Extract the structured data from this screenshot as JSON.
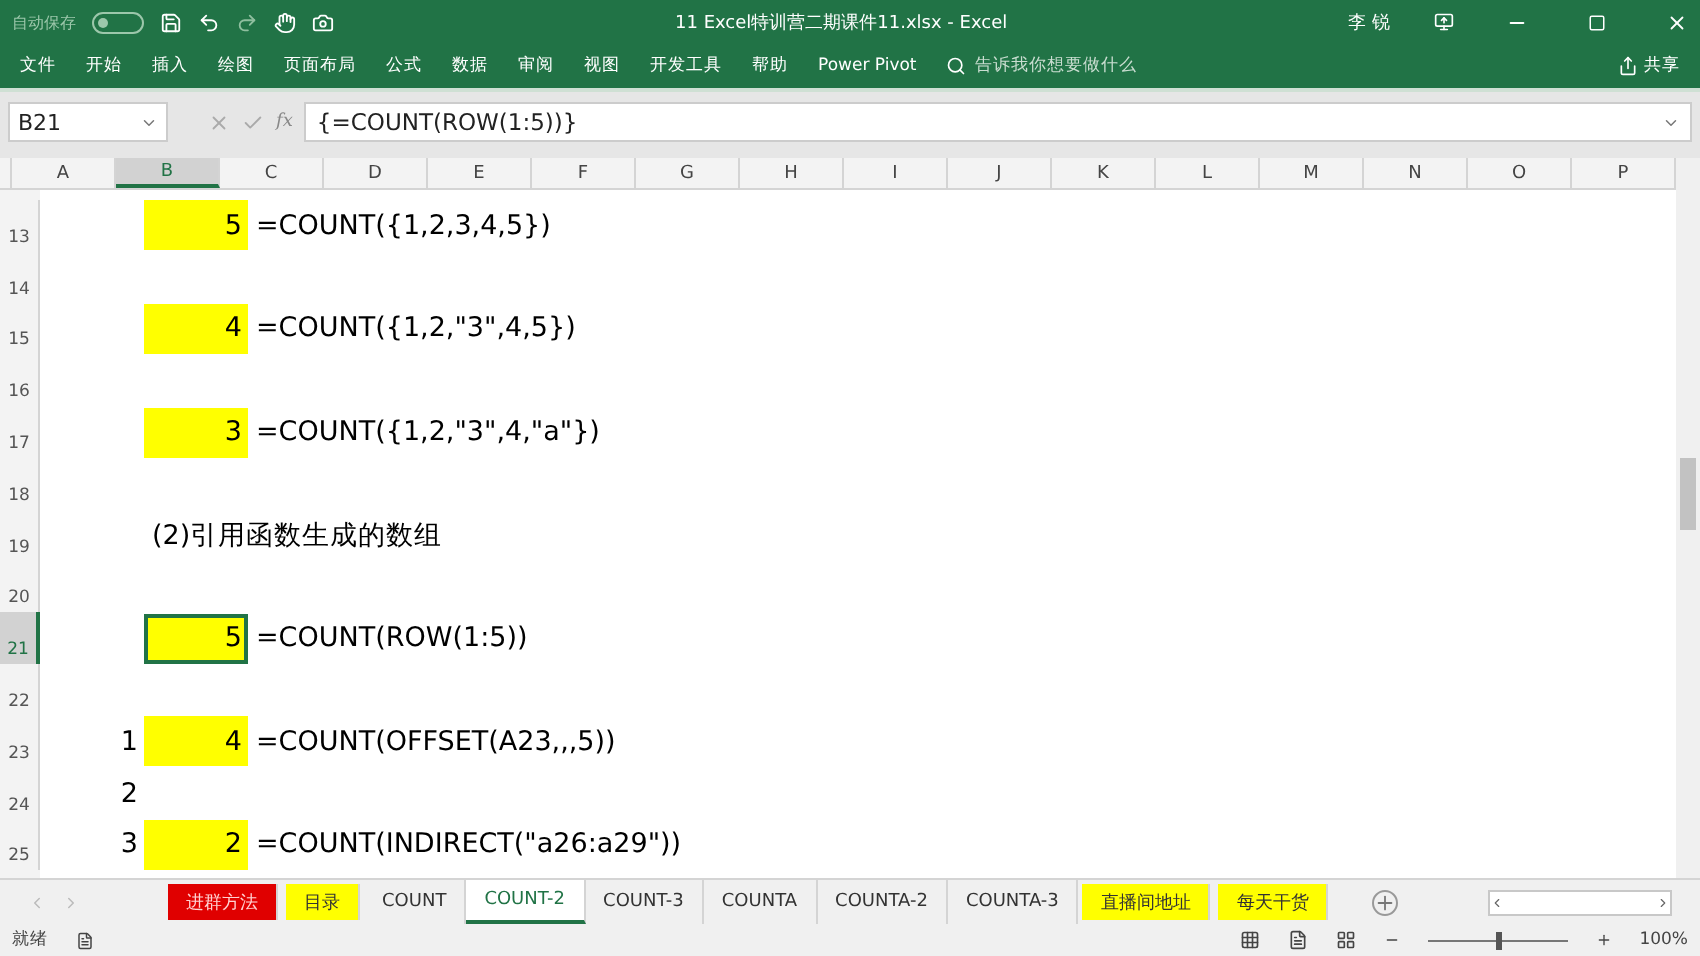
{
  "title_bar": {
    "autosave_label": "自动保存",
    "autosave_on": false,
    "title": "11 Excel特训营二期课件11.xlsx  -  Excel",
    "user": "李 锐"
  },
  "ribbon_tabs": [
    {
      "label": "文件"
    },
    {
      "label": "开始"
    },
    {
      "label": "插入"
    },
    {
      "label": "绘图"
    },
    {
      "label": "页面布局"
    },
    {
      "label": "公式"
    },
    {
      "label": "数据"
    },
    {
      "label": "审阅"
    },
    {
      "label": "视图"
    },
    {
      "label": "开发工具"
    },
    {
      "label": "帮助"
    },
    {
      "label": "Power Pivot"
    }
  ],
  "tell_me": {
    "placeholder": "告诉我你想要做什么"
  },
  "share": "共享",
  "formula_bar": {
    "name_box": "B21",
    "function_label": "fx",
    "formula": "{=COUNT(ROW(1:5))}"
  },
  "columns": [
    {
      "label": "A",
      "selected": false
    },
    {
      "label": "B",
      "selected": true
    },
    {
      "label": "C",
      "selected": false
    },
    {
      "label": "D",
      "selected": false
    },
    {
      "label": "E",
      "selected": false
    },
    {
      "label": "F",
      "selected": false
    },
    {
      "label": "G",
      "selected": false
    },
    {
      "label": "H",
      "selected": false
    },
    {
      "label": "I",
      "selected": false
    },
    {
      "label": "J",
      "selected": false
    },
    {
      "label": "K",
      "selected": false
    },
    {
      "label": "L",
      "selected": false
    },
    {
      "label": "M",
      "selected": false
    },
    {
      "label": "N",
      "selected": false
    },
    {
      "label": "O",
      "selected": false
    },
    {
      "label": "P",
      "selected": false
    }
  ],
  "rows": [
    {
      "number": "13",
      "selected": false,
      "col_b": {
        "text": "5",
        "kind": "number",
        "highlighted": true,
        "selected": false
      },
      "col_c": {
        "text": "=COUNT({1,2,3,4,5})"
      }
    },
    {
      "number": "14",
      "selected": false
    },
    {
      "number": "15",
      "selected": false,
      "col_b": {
        "text": "4",
        "kind": "number",
        "highlighted": true,
        "selected": false
      },
      "col_c": {
        "text": "=COUNT({1,2,\"3\",4,5})"
      }
    },
    {
      "number": "16",
      "selected": false
    },
    {
      "number": "17",
      "selected": false,
      "col_b": {
        "text": "3",
        "kind": "number",
        "highlighted": true,
        "selected": false
      },
      "col_c": {
        "text": "=COUNT({1,2,\"3\",4,\"a\"})"
      }
    },
    {
      "number": "18",
      "selected": false
    },
    {
      "number": "19",
      "selected": false,
      "col_b": {
        "text": "(2)引用函数生成的数组",
        "kind": "text",
        "highlighted": false,
        "selected": false
      }
    },
    {
      "number": "20",
      "selected": false
    },
    {
      "number": "21",
      "selected": true,
      "col_b": {
        "text": "5",
        "kind": "number",
        "highlighted": true,
        "selected": true
      },
      "col_c": {
        "text": "=COUNT(ROW(1:5))"
      }
    },
    {
      "number": "22",
      "selected": false
    },
    {
      "number": "23",
      "selected": false,
      "col_a": {
        "text": "1",
        "kind": "number"
      },
      "col_b": {
        "text": "4",
        "kind": "number",
        "highlighted": true,
        "selected": false
      },
      "col_c": {
        "text": "=COUNT(OFFSET(A23,,,5))"
      }
    },
    {
      "number": "24",
      "selected": false,
      "col_a": {
        "text": "2",
        "kind": "number"
      }
    },
    {
      "number": "25",
      "selected": false,
      "col_a": {
        "text": "3",
        "kind": "number"
      },
      "col_b": {
        "text": "2",
        "kind": "number",
        "highlighted": true,
        "selected": false
      },
      "col_c": {
        "text": "=COUNT(INDIRECT(\"a26:a29\"))"
      }
    }
  ],
  "sheet_tabs": [
    {
      "label": "进群方法",
      "color": "#e00000",
      "selected": false
    },
    {
      "label": "目录",
      "color": "#ffff00",
      "selected": false
    },
    {
      "label": "COUNT",
      "selected": false
    },
    {
      "label": "COUNT-2",
      "selected": true
    },
    {
      "label": "COUNT-3",
      "selected": false
    },
    {
      "label": "COUNTA",
      "selected": false
    },
    {
      "label": "COUNTA-2",
      "selected": false
    },
    {
      "label": "COUNTA-3",
      "selected": false
    },
    {
      "label": "直播间地址",
      "color": "#ffff00",
      "selected": false
    },
    {
      "label": "每天干货",
      "color": "#ffff00",
      "selected": false
    }
  ],
  "status_bar": {
    "status": "就绪",
    "zoom": "100%",
    "zoom_slider": {
      "level": 0.5
    }
  }
}
